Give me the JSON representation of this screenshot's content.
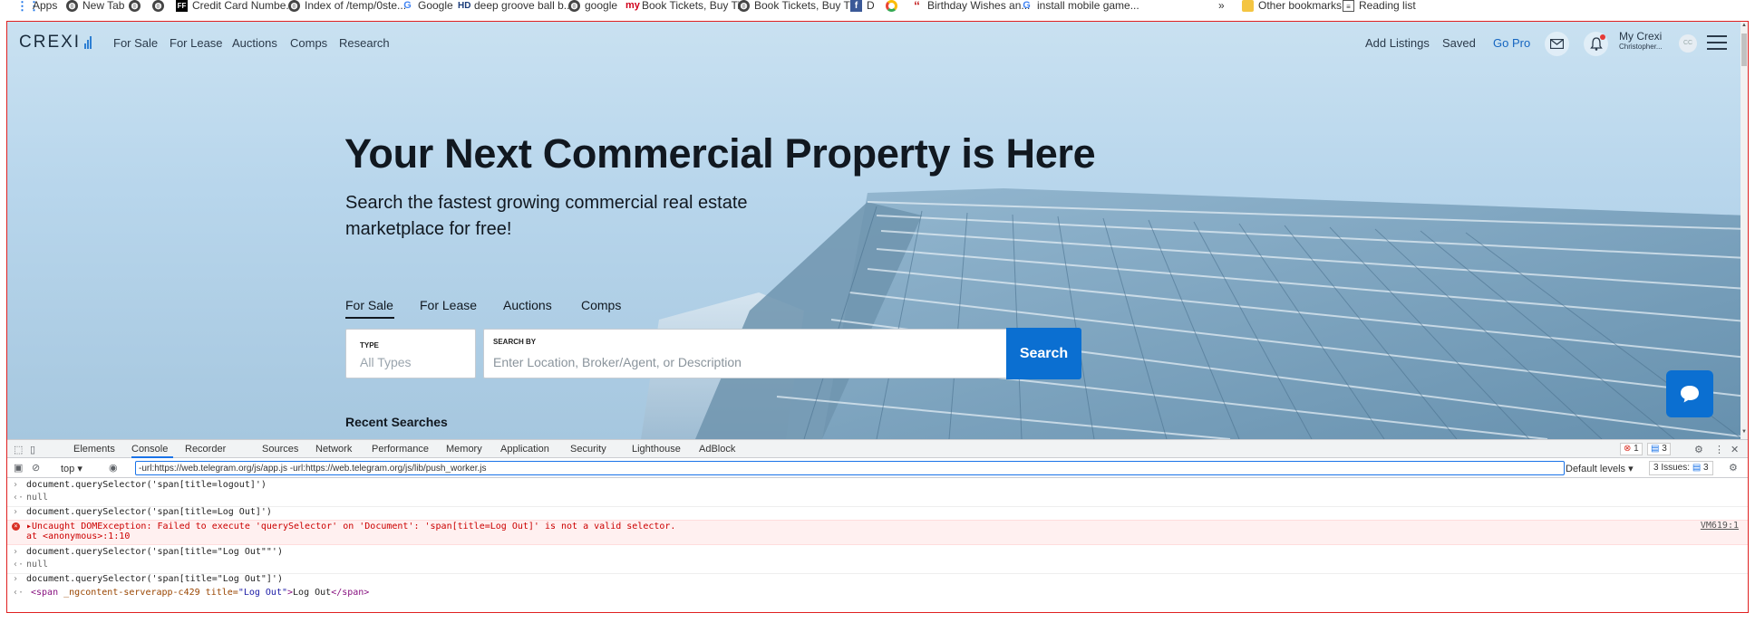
{
  "bookmarks": [
    {
      "label": "Apps",
      "icon": "apps-icon"
    },
    {
      "label": "New Tab",
      "icon": "globe-icon"
    },
    {
      "label": "",
      "icon": "globe-icon"
    },
    {
      "label": "",
      "icon": "globe-icon"
    },
    {
      "label": "Credit Card Numbe...",
      "icon": "ff-icon"
    },
    {
      "label": "Index of /temp/0ste...",
      "icon": "globe-icon"
    },
    {
      "label": "Google",
      "icon": "google-icon"
    },
    {
      "label": "deep groove ball b...",
      "icon": "hd-icon"
    },
    {
      "label": "google",
      "icon": "globe-icon"
    },
    {
      "label": "Book Tickets, Buy Ti...",
      "icon": "makemytrip-icon"
    },
    {
      "label": "Book Tickets, Buy Ti...",
      "icon": "globe-icon"
    },
    {
      "label": "D",
      "icon": "facebook-icon"
    },
    {
      "label": "",
      "icon": "ring-icon"
    },
    {
      "label": "Birthday Wishes an...",
      "icon": "quote-icon"
    },
    {
      "label": "install mobile game...",
      "icon": "google-icon"
    }
  ],
  "bookmarks_overflow": "»",
  "other_bookmarks": "Other bookmarks",
  "reading_list": "Reading list",
  "nav": {
    "logo": "CREXI",
    "links": [
      "For Sale",
      "For Lease",
      "Auctions",
      "Comps",
      "Research"
    ],
    "add_listings": "Add Listings",
    "saved": "Saved",
    "go_pro": "Go Pro",
    "my_crexi": "My Crexi",
    "user_name": "Christopher...",
    "avatar_initials": "CC"
  },
  "hero": {
    "title": "Your Next Commercial Property is Here",
    "subtitle": "Search the fastest growing commercial real estate marketplace for free!"
  },
  "search": {
    "tabs": [
      "For Sale",
      "For Lease",
      "Auctions",
      "Comps"
    ],
    "active_tab": "For Sale",
    "type_label": "TYPE",
    "type_value": "All Types",
    "search_by_label": "SEARCH BY",
    "placeholder": "Enter Location, Broker/Agent, or Description",
    "button": "Search"
  },
  "recent_searches": "Recent Searches",
  "devtools": {
    "tabs": [
      "Elements",
      "Console",
      "Recorder",
      "Sources",
      "Network",
      "Performance",
      "Memory",
      "Application",
      "Security",
      "Lighthouse",
      "AdBlock"
    ],
    "active_tab": "Console",
    "error_count": "1",
    "message_count": "3",
    "context": "top",
    "filter": "-url:https://web.telegram.org/js/app.js -url:https://web.telegram.org/js/lib/push_worker.js",
    "default_levels": "Default levels",
    "issues": "3 Issues:",
    "issues_count": "3"
  },
  "console": [
    {
      "kind": "input",
      "text": "document.querySelector('span[title=logout]')"
    },
    {
      "kind": "result",
      "text": "null"
    },
    {
      "kind": "input",
      "text": "document.querySelector('span[title=Log Out]')"
    },
    {
      "kind": "error",
      "text": "▸Uncaught DOMException: Failed to execute 'querySelector' on 'Document': 'span[title=Log Out]' is not a valid selector.",
      "text2": "    at <anonymous>:1:10",
      "link": "VM619:1"
    },
    {
      "kind": "input",
      "text": "document.querySelector('span[title=\"Log Out\"\"')"
    },
    {
      "kind": "result",
      "text": "null"
    },
    {
      "kind": "input",
      "text": "document.querySelector('span[title=\"Log Out\"]')"
    }
  ],
  "console_output": {
    "open": "<span",
    "attr1": " _ngcontent-serverapp-c429",
    "attr2": " title=",
    "attr2_val": "\"Log Out\"",
    "close": ">",
    "inner": "Log Out",
    "end": "</span>"
  }
}
